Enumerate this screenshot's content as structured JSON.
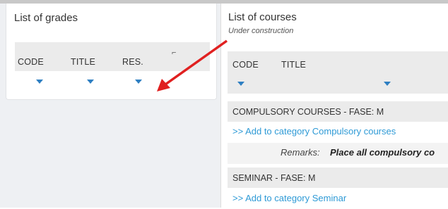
{
  "grades_panel": {
    "title": "List of grades",
    "columns": [
      "CODE",
      "TITLE",
      "RES."
    ],
    "sort_symbol": "⌐"
  },
  "courses_panel": {
    "title": "List of courses",
    "subtitle": "Under construction",
    "columns": [
      "CODE",
      "TITLE"
    ],
    "rows": [
      {
        "type": "category",
        "label": "COMPULSORY COURSES - FASE: M"
      },
      {
        "type": "link",
        "label": ">> Add to category Compulsory courses"
      },
      {
        "type": "remarks",
        "label": "Remarks:",
        "value": "Place all compulsory co"
      },
      {
        "type": "category",
        "label": "SEMINAR - FASE: M"
      },
      {
        "type": "link",
        "label": ">> Add to category Seminar"
      }
    ]
  },
  "colors": {
    "filter": "#2e7fc2",
    "link": "#2e9ad6",
    "annotation_arrow": "#e02020"
  }
}
